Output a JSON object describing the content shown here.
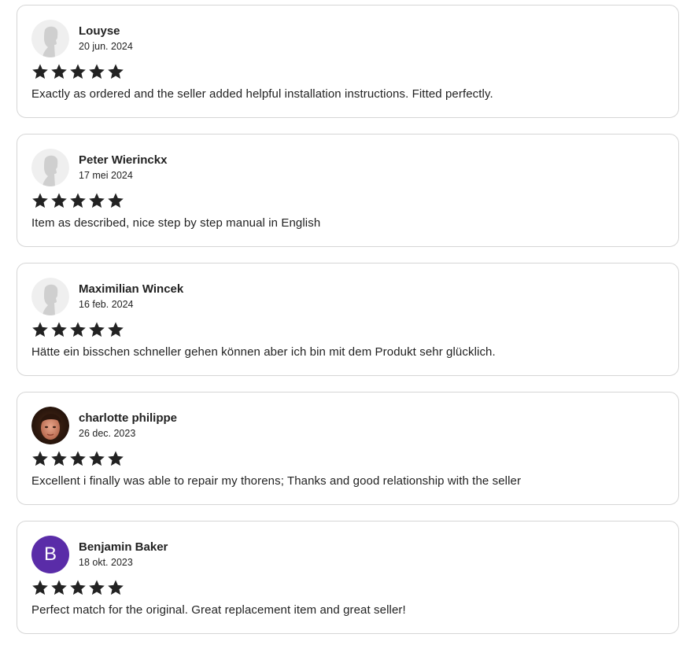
{
  "reviews": [
    {
      "name": "Louyse",
      "date": "20 jun. 2024",
      "rating": 5,
      "text": "Exactly as ordered and the seller added helpful installation instructions. Fitted perfectly.",
      "avatar": {
        "kind": "placeholder"
      }
    },
    {
      "name": "Peter Wierinckx",
      "date": "17 mei 2024",
      "rating": 5,
      "text": "Item as described, nice step by step manual in English",
      "avatar": {
        "kind": "placeholder"
      }
    },
    {
      "name": "Maximilian Wincek",
      "date": "16 feb. 2024",
      "rating": 5,
      "text": "Hätte ein bisschen schneller gehen können aber ich bin mit dem Produkt sehr glücklich.",
      "avatar": {
        "kind": "placeholder"
      }
    },
    {
      "name": "charlotte philippe",
      "date": "26 dec. 2023",
      "rating": 5,
      "text": "Excellent i finally was able to repair my thorens; Thanks and good relationship with the seller",
      "avatar": {
        "kind": "photo"
      }
    },
    {
      "name": "Benjamin Baker",
      "date": "18 okt. 2023",
      "rating": 5,
      "text": "Perfect match for the original. Great replacement item and great seller!",
      "avatar": {
        "kind": "initial",
        "letter": "B",
        "color": "#5a2ca8"
      }
    }
  ],
  "colors": {
    "star": "#222222",
    "border": "#d6d6d6",
    "placeholder_bg": "#efefef",
    "placeholder_figure": "#cfcfcf"
  }
}
